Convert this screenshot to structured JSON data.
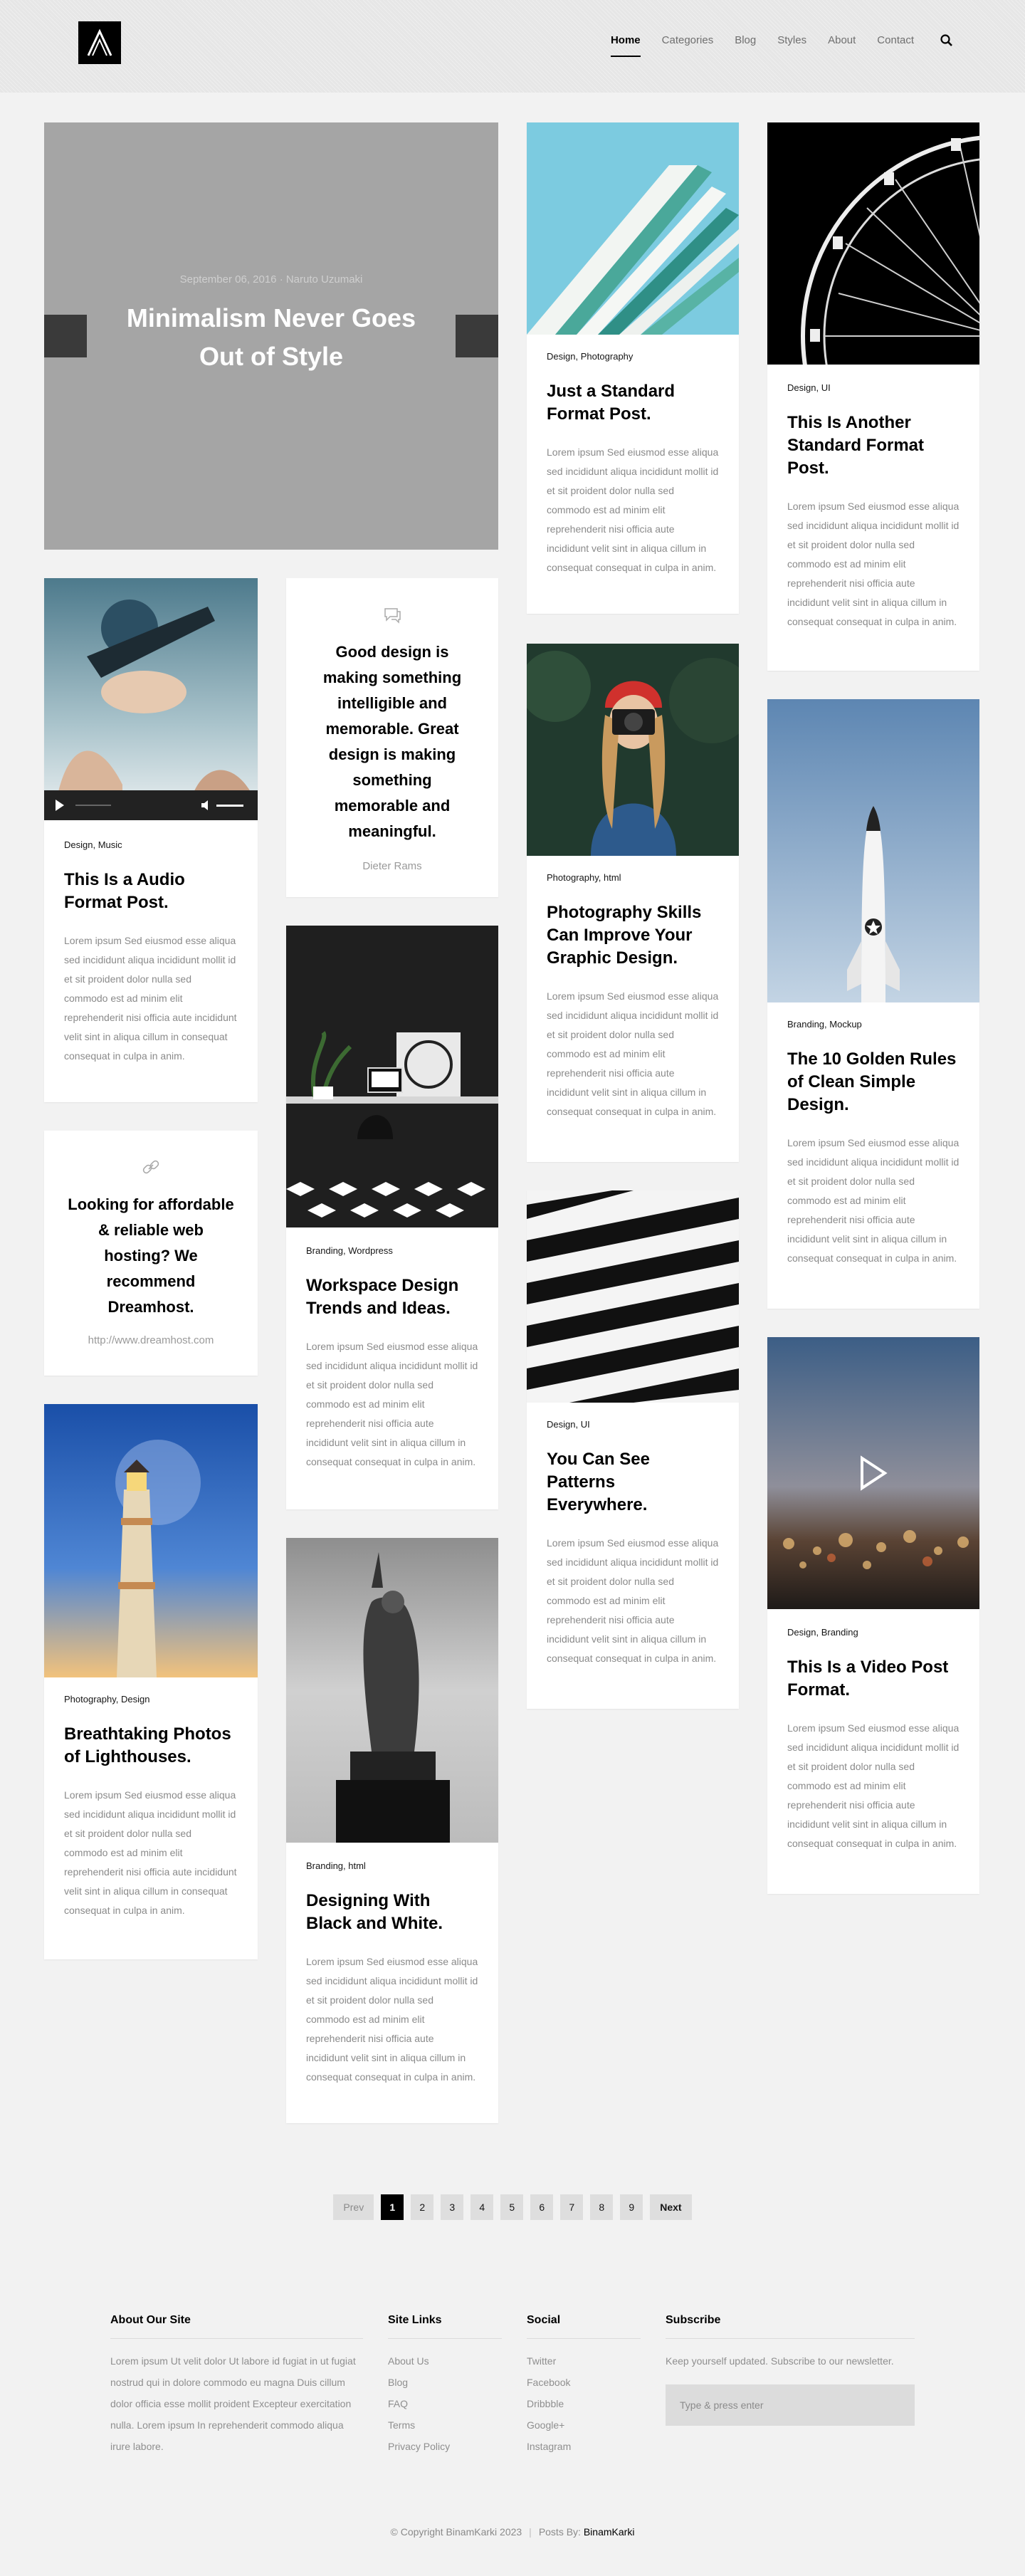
{
  "nav": {
    "items": [
      {
        "label": "Home",
        "active": true
      },
      {
        "label": "Categories"
      },
      {
        "label": "Blog"
      },
      {
        "label": "Styles"
      },
      {
        "label": "About"
      },
      {
        "label": "Contact"
      }
    ],
    "search_icon": "search-icon"
  },
  "hero": {
    "meta": "September 06, 2016 · Naruto Uzumaki",
    "title": "Minimalism Never Goes Out of Style"
  },
  "lorem": "Lorem ipsum Sed eiusmod esse aliqua sed incididunt aliqua incididunt mollit id et sit proident dolor nulla sed commodo est ad minim elit reprehenderit nisi officia aute incididunt velit sint in aliqua cillum in consequat consequat in culpa in anim.",
  "posts": {
    "audio": {
      "cats": "Design, Music",
      "title": "This Is a Audio Format Post."
    },
    "quote": {
      "text": "Good design is making something intelligible and memorable. Great design is making something memorable and meaningful.",
      "source": "Dieter Rams"
    },
    "link": {
      "text": "Looking for affordable & reliable web hosting? We recommend Dreamhost.",
      "url": "http://www.dreamhost.com"
    },
    "lighthouse": {
      "cats": "Photography, Design",
      "title": "Breathtaking Photos of Lighthouses."
    },
    "workspace": {
      "cats": "Branding, Wordpress",
      "title": "Workspace Design Trends and Ideas."
    },
    "liberty": {
      "cats": "Branding, html",
      "title": "Designing With Black and White."
    },
    "standard": {
      "cats": "Design, Photography",
      "title": "Just a Standard Format Post."
    },
    "photo": {
      "cats": "Photography, html",
      "title": "Photography Skills Can Improve Your Graphic Design."
    },
    "patterns": {
      "cats": "Design, UI",
      "title": "You Can See Patterns Everywhere."
    },
    "another": {
      "cats": "Design, UI",
      "title": "This Is Another Standard Format Post."
    },
    "rules": {
      "cats": "Branding, Mockup",
      "title": "The 10 Golden Rules of Clean Simple Design."
    },
    "video": {
      "cats": "Design, Branding",
      "title": "This Is a Video Post Format."
    }
  },
  "pagination": {
    "prev": "Prev",
    "pages": [
      "1",
      "2",
      "3",
      "4",
      "5",
      "6",
      "7",
      "8",
      "9"
    ],
    "current": "1",
    "next": "Next"
  },
  "footer": {
    "about": {
      "heading": "About Our Site",
      "text": "Lorem ipsum Ut velit dolor Ut labore id fugiat in ut fugiat nostrud qui in dolore commodo eu magna Duis cillum dolor officia esse mollit proident Excepteur exercitation nulla. Lorem ipsum In reprehenderit commodo aliqua irure labore."
    },
    "links": {
      "heading": "Site Links",
      "items": [
        "About Us",
        "Blog",
        "FAQ",
        "Terms",
        "Privacy Policy"
      ]
    },
    "social": {
      "heading": "Social",
      "items": [
        "Twitter",
        "Facebook",
        "Dribbble",
        "Google+",
        "Instagram"
      ]
    },
    "subscribe": {
      "heading": "Subscribe",
      "text": "Keep yourself updated. Subscribe to our newsletter.",
      "placeholder": "Type & press enter"
    },
    "copyright": "© Copyright BinamKarki 2023",
    "posts_by_label": "Posts By:",
    "posts_by_name": "BinamKarki"
  }
}
